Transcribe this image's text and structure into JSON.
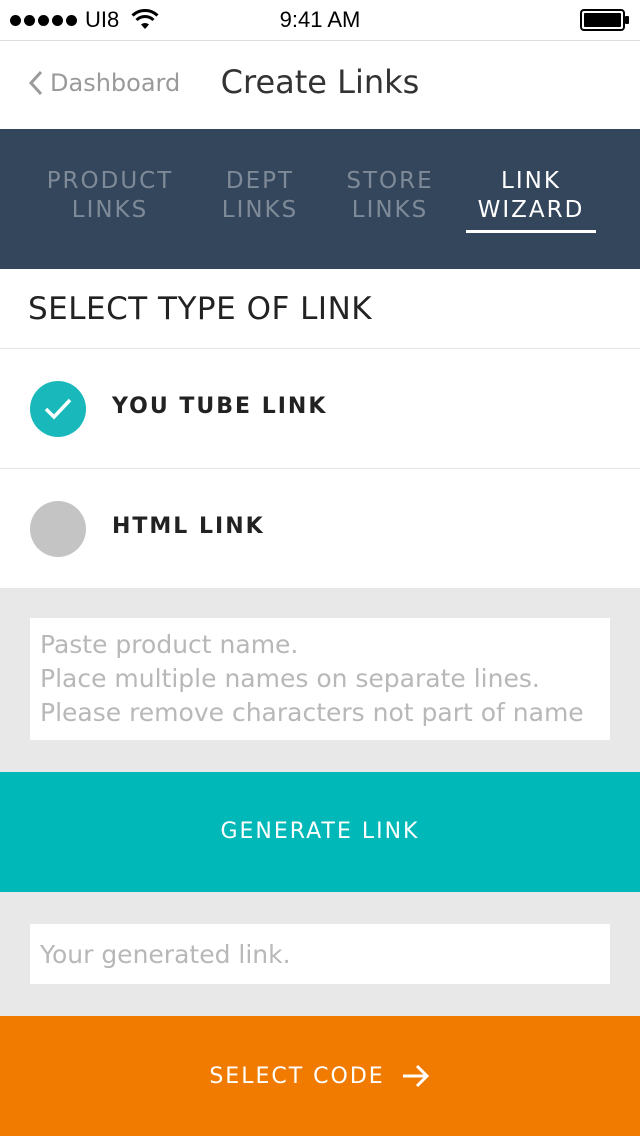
{
  "status_bar": {
    "carrier": "UI8",
    "time": "9:41 AM"
  },
  "nav": {
    "back_label": "Dashboard",
    "title": "Create Links"
  },
  "tabs": [
    {
      "line1": "PRODUCT",
      "line2": "LINKS",
      "active": false
    },
    {
      "line1": "DEPT",
      "line2": "LINKS",
      "active": false
    },
    {
      "line1": "STORE",
      "line2": "LINKS",
      "active": false
    },
    {
      "line1": "LINK",
      "line2": "WIZARD",
      "active": true
    }
  ],
  "section": {
    "title": "SELECT TYPE OF LINK"
  },
  "options": [
    {
      "label": "YOU TUBE LINK",
      "selected": true
    },
    {
      "label": "HTML LINK",
      "selected": false
    }
  ],
  "product_input": {
    "placeholder": "Paste product name.\nPlace multiple names on separate lines.\nPlease remove characters not part of name"
  },
  "generate_button": {
    "label": "GENERATE LINK"
  },
  "link_output": {
    "placeholder": "Your generated link."
  },
  "select_code_button": {
    "label": "SELECT CODE",
    "icon": "arrow-right-icon"
  },
  "colors": {
    "tab_bar": "#34465c",
    "accent_teal": "#00b8b8",
    "accent_orange": "#f07b00",
    "radio_unchecked": "#c4c4c4"
  }
}
